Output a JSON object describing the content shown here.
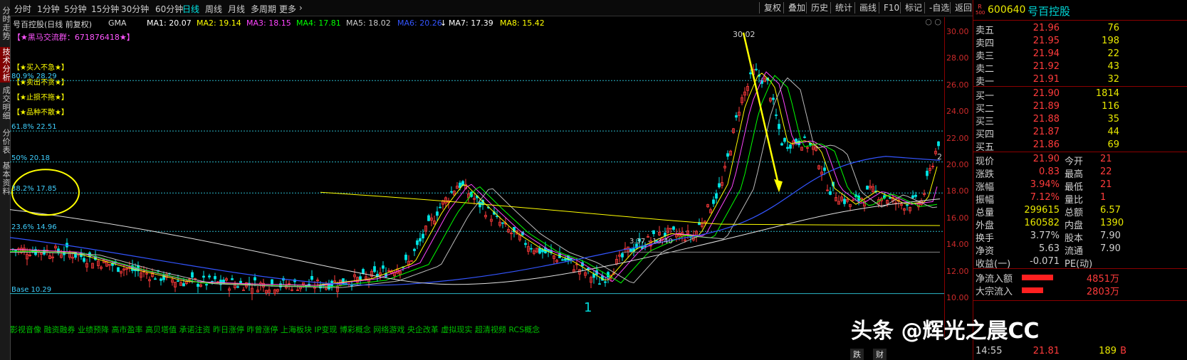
{
  "left_tabs": [
    {
      "label": "分时走势",
      "active": false
    },
    {
      "label": "技术分析",
      "active": true
    },
    {
      "label": "成交明细",
      "active": false
    },
    {
      "label": "分价表",
      "active": false
    },
    {
      "label": "基本资料",
      "active": false
    }
  ],
  "toolbar": {
    "periods": [
      "分时",
      "1分钟",
      "5分钟",
      "15分钟",
      "30分钟",
      "60分钟",
      "日线",
      "周线",
      "月线",
      "多周期",
      "更多"
    ],
    "active_period": "日线",
    "more_arrow": "›",
    "right_buttons": [
      "复权",
      "叠加",
      "历史",
      "统计",
      "画线",
      "F10",
      "标记",
      "-自选",
      "返回"
    ]
  },
  "chart_header": {
    "title": "号百控股(日线 前复权)",
    "indicator": "GMA",
    "ma": [
      {
        "label": "MA1: 20.07",
        "color": "#ffffff"
      },
      {
        "label": "MA2: 19.14",
        "color": "#ffff00"
      },
      {
        "label": "MA3: 18.15",
        "color": "#ff44ff"
      },
      {
        "label": "MA4: 17.81",
        "color": "#00ff00"
      },
      {
        "label": "MA5: 18.02",
        "color": "#cccccc"
      },
      {
        "label": "MA6: 20.26",
        "color": "#3355ff"
      },
      {
        "label": "MA7: 17.39",
        "color": "#ffffff"
      },
      {
        "label": "MA8: 15.42",
        "color": "#ffff00"
      }
    ],
    "arrow": "↓"
  },
  "chart_notes": {
    "banner": "【★黑马交流群：671876418★】",
    "tips": [
      "【★买入不急★】",
      "【★卖出不贪★】",
      "【★止损不拖★】",
      "【★品种不散★】"
    ],
    "peak_label": "30.02",
    "low_label": "3.37 - 13.40",
    "cycle_label": "1",
    "fib_levels": [
      {
        "label": "80.9% 28.29",
        "price": 26.3
      },
      {
        "label": "61.8% 22.51",
        "price": 22.51
      },
      {
        "label": "50% 20.18",
        "price": 20.18
      },
      {
        "label": "38.2% 17.85",
        "price": 17.85
      },
      {
        "label": "23.6% 14.96",
        "price": 14.96
      },
      {
        "label": "Base 10.29",
        "price": 10.29
      }
    ],
    "edge_label": "2"
  },
  "price_axis": {
    "ticks": [
      "30.00",
      "28.00",
      "26.00",
      "24.00",
      "22.00",
      "20.00",
      "18.00",
      "16.00",
      "14.00",
      "12.00",
      "10.00"
    ],
    "range": [
      10,
      30
    ]
  },
  "concepts": "影视音像 融资融券 业绩预降 高市盈率 高贝塔值 承诺注资 昨日涨停 昨曾涨停 上海板块 IP变现 博彩概念 网络游戏 央企改革 虚拟现实 超清视频 RCS概念",
  "quote_panel": {
    "code": "600640",
    "name": "号百控股",
    "r_badge": "R",
    "r_num": "500",
    "asks": [
      {
        "label": "卖五",
        "price": "21.96",
        "vol": "76"
      },
      {
        "label": "卖四",
        "price": "21.95",
        "vol": "198"
      },
      {
        "label": "卖三",
        "price": "21.94",
        "vol": "22"
      },
      {
        "label": "卖二",
        "price": "21.92",
        "vol": "43"
      },
      {
        "label": "卖一",
        "price": "21.91",
        "vol": "32"
      }
    ],
    "bids": [
      {
        "label": "买一",
        "price": "21.90",
        "vol": "1814"
      },
      {
        "label": "买二",
        "price": "21.89",
        "vol": "116"
      },
      {
        "label": "买三",
        "price": "21.88",
        "vol": "35"
      },
      {
        "label": "买四",
        "price": "21.87",
        "vol": "44"
      },
      {
        "label": "买五",
        "price": "21.86",
        "vol": "69"
      }
    ],
    "stats": [
      {
        "l1": "现价",
        "v1": "21.90",
        "l2": "今开",
        "v2": "21"
      },
      {
        "l1": "涨跌",
        "v1": "0.83",
        "l2": "最高",
        "v2": "22"
      },
      {
        "l1": "涨幅",
        "v1": "3.94%",
        "l2": "最低",
        "v2": "21"
      },
      {
        "l1": "振幅",
        "v1": "7.12%",
        "l2": "量比",
        "v2": "1"
      },
      {
        "l1": "总量",
        "v1": "299615",
        "l2": "总额",
        "v2": "6.57"
      },
      {
        "l1": "外盘",
        "v1": "160582",
        "l2": "内盘",
        "v2": "1390"
      },
      {
        "l1": "换手",
        "v1": "3.77%",
        "l2": "股本",
        "v2": "7.90"
      },
      {
        "l1": "净资",
        "v1": "5.63",
        "l2": "流通",
        "v2": "7.90"
      },
      {
        "l1": "收益(一)",
        "v1": "-0.071",
        "l2": "PE(动)",
        "v2": ""
      }
    ],
    "flows": [
      {
        "label": "净流入额",
        "value": "4851万"
      },
      {
        "label": "大宗流入",
        "value": "2803万"
      }
    ],
    "ticks": [
      {
        "time": "14:55",
        "price": "21.81",
        "vol": "189",
        "dir": "B"
      }
    ]
  },
  "bottom_tabs": [
    "跌",
    "财"
  ],
  "watermark": "头条 @辉光之晨CC",
  "colors": {
    "up": "#ff3b3b",
    "down": "#00e5e5",
    "accent": "#800000",
    "axis": "#cc2a2a"
  },
  "chart_data": {
    "type": "candlestick",
    "ylim": [
      10,
      30
    ],
    "peak": 30.02,
    "series_hint": "daily k-line with 8 moving averages"
  }
}
